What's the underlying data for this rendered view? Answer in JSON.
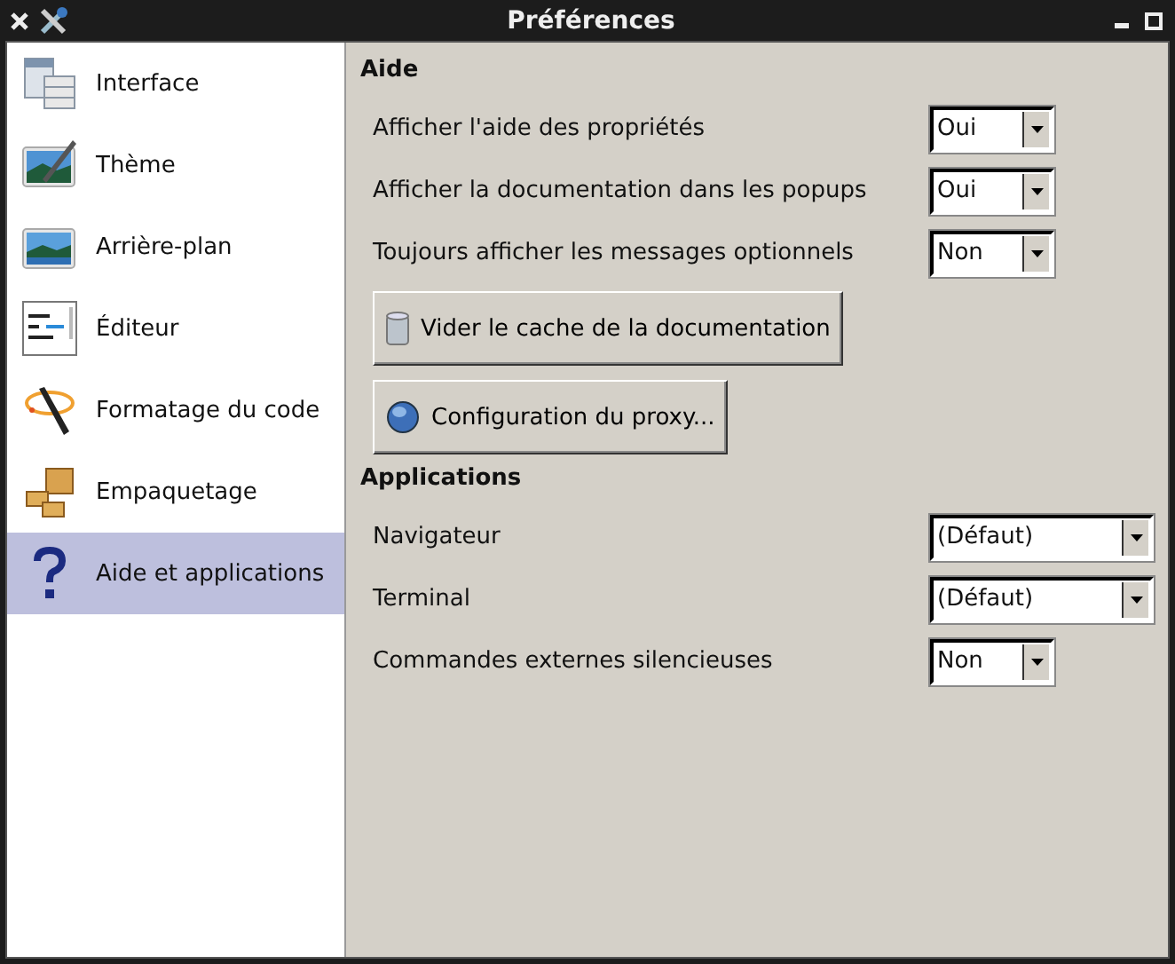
{
  "window": {
    "title": "Préférences"
  },
  "sidebar": {
    "items": [
      {
        "label": "Interface",
        "selected": false
      },
      {
        "label": "Thème",
        "selected": false
      },
      {
        "label": "Arrière-plan",
        "selected": false
      },
      {
        "label": "Éditeur",
        "selected": false
      },
      {
        "label": "Formatage du code",
        "selected": false
      },
      {
        "label": "Empaquetage",
        "selected": false
      },
      {
        "label": "Aide et applications",
        "selected": true
      }
    ]
  },
  "sections": [
    {
      "title": "Aide",
      "items": [
        {
          "kind": "select",
          "label": "Afficher l'aide des propriétés",
          "value": "Oui"
        },
        {
          "kind": "select",
          "label": "Afficher la documentation dans les popups",
          "value": "Oui"
        },
        {
          "kind": "select",
          "label": "Toujours afficher les messages optionnels",
          "value": "Non"
        },
        {
          "kind": "button",
          "label": "Vider le cache de la documentation"
        },
        {
          "kind": "button",
          "label": "Configuration du proxy..."
        }
      ]
    },
    {
      "title": "Applications",
      "items": [
        {
          "kind": "wide-select",
          "label": "Navigateur",
          "value": "(Défaut)"
        },
        {
          "kind": "wide-select",
          "label": "Terminal",
          "value": "(Défaut)"
        },
        {
          "kind": "select",
          "label": "Commandes externes silencieuses",
          "value": "Non"
        }
      ]
    }
  ]
}
